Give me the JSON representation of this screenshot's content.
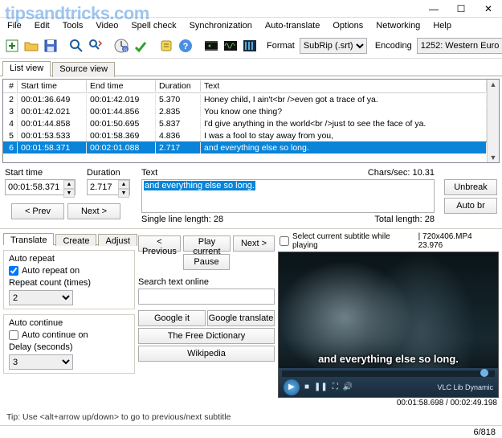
{
  "watermark": "tipsandtricks.com",
  "window": {
    "min": "—",
    "max": "☐",
    "close": "✕"
  },
  "menu": [
    "File",
    "Edit",
    "Tools",
    "Video",
    "Spell check",
    "Synchronization",
    "Auto-translate",
    "Options",
    "Networking",
    "Help"
  ],
  "toolbar": {
    "format_label": "Format",
    "format_value": "SubRip (.srt)",
    "encoding_label": "Encoding",
    "encoding_value": "1252: Western Euro"
  },
  "view_tabs": {
    "list": "List view",
    "source": "Source view"
  },
  "grid": {
    "headers": [
      "#",
      "Start time",
      "End time",
      "Duration",
      "Text"
    ],
    "rows": [
      {
        "n": "2",
        "st": "00:01:36.649",
        "et": "00:01:42.019",
        "d": "5.370",
        "t": "Honey child, I ain't<br />even got a trace of ya."
      },
      {
        "n": "3",
        "st": "00:01:42.021",
        "et": "00:01:44.856",
        "d": "2.835",
        "t": "You know one thing?"
      },
      {
        "n": "4",
        "st": "00:01:44.858",
        "et": "00:01:50.695",
        "d": "5.837",
        "t": "I'd give anything in the world<br />just to see the face of ya."
      },
      {
        "n": "5",
        "st": "00:01:53.533",
        "et": "00:01:58.369",
        "d": "4.836",
        "t": "I was a fool to stay away from you,"
      },
      {
        "n": "6",
        "st": "00:01:58.371",
        "et": "00:02:01.088",
        "d": "2.717",
        "t": "and everything else so long."
      }
    ],
    "selected_index": 4
  },
  "edit": {
    "start_label": "Start time",
    "start_value": "00:01:58.371",
    "duration_label": "Duration",
    "duration_value": "2.717",
    "text_label": "Text",
    "text_value": "and everything else so long.",
    "cps_label": "Chars/sec:",
    "cps_value": "10.31",
    "single_line_label": "Single line length:",
    "single_line_value": "28",
    "total_label": "Total length:",
    "total_value": "28",
    "unbreak": "Unbreak",
    "autobr": "Auto br",
    "prev": "< Prev",
    "next": "Next >"
  },
  "bottom_tabs": {
    "translate": "Translate",
    "create": "Create",
    "adjust": "Adjust"
  },
  "auto_repeat": {
    "group": "Auto repeat",
    "on": "Auto repeat on",
    "on_checked": true,
    "count_label": "Repeat count (times)",
    "count_value": "2"
  },
  "auto_continue": {
    "group": "Auto continue",
    "on": "Auto continue on",
    "on_checked": false,
    "delay_label": "Delay (seconds)",
    "delay_value": "3"
  },
  "play": {
    "prev": "< Previous",
    "play": "Play current",
    "next": "Next >",
    "pause": "Pause",
    "search_label": "Search text online",
    "search_value": "",
    "google": "Google it",
    "gtrans": "Google translate",
    "tfd": "The Free Dictionary",
    "wiki": "Wikipedia"
  },
  "video": {
    "select_label": "Select current subtitle while playing",
    "select_checked": false,
    "info": "| 720x406.MP4 23.976",
    "subtitle": "and everything else so long.",
    "time": "00:01:58.698 / 00:02:49.198",
    "brand": "VLC Lib Dynamic"
  },
  "tip": "Tip: Use <alt+arrow up/down> to go to previous/next subtitle",
  "status": "6/818"
}
